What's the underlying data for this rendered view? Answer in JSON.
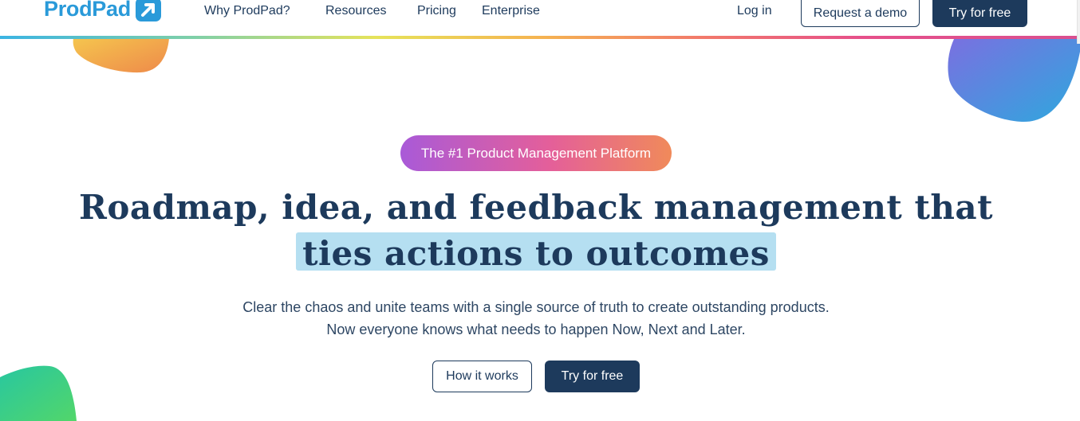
{
  "header": {
    "logo_text": "ProdPad",
    "nav": [
      "Why ProdPad?",
      "Resources",
      "Pricing",
      "Enterprise"
    ],
    "login_label": "Log in",
    "demo_label": "Request a demo",
    "try_label": "Try for free"
  },
  "hero": {
    "badge": "The #1 Product Management Platform",
    "headline_line1": "Roadmap, idea, and feedback management that",
    "headline_highlight": "ties actions to outcomes",
    "subtext": "Clear the chaos and unite teams with a single source of truth to create outstanding products. Now everyone knows what needs to happen Now, Next and Later.",
    "how_label": "How it works",
    "try_label": "Try for free"
  },
  "colors": {
    "brand_blue": "#2a9ad9",
    "navy": "#1d3a5c",
    "highlight": "#b5dff1"
  }
}
